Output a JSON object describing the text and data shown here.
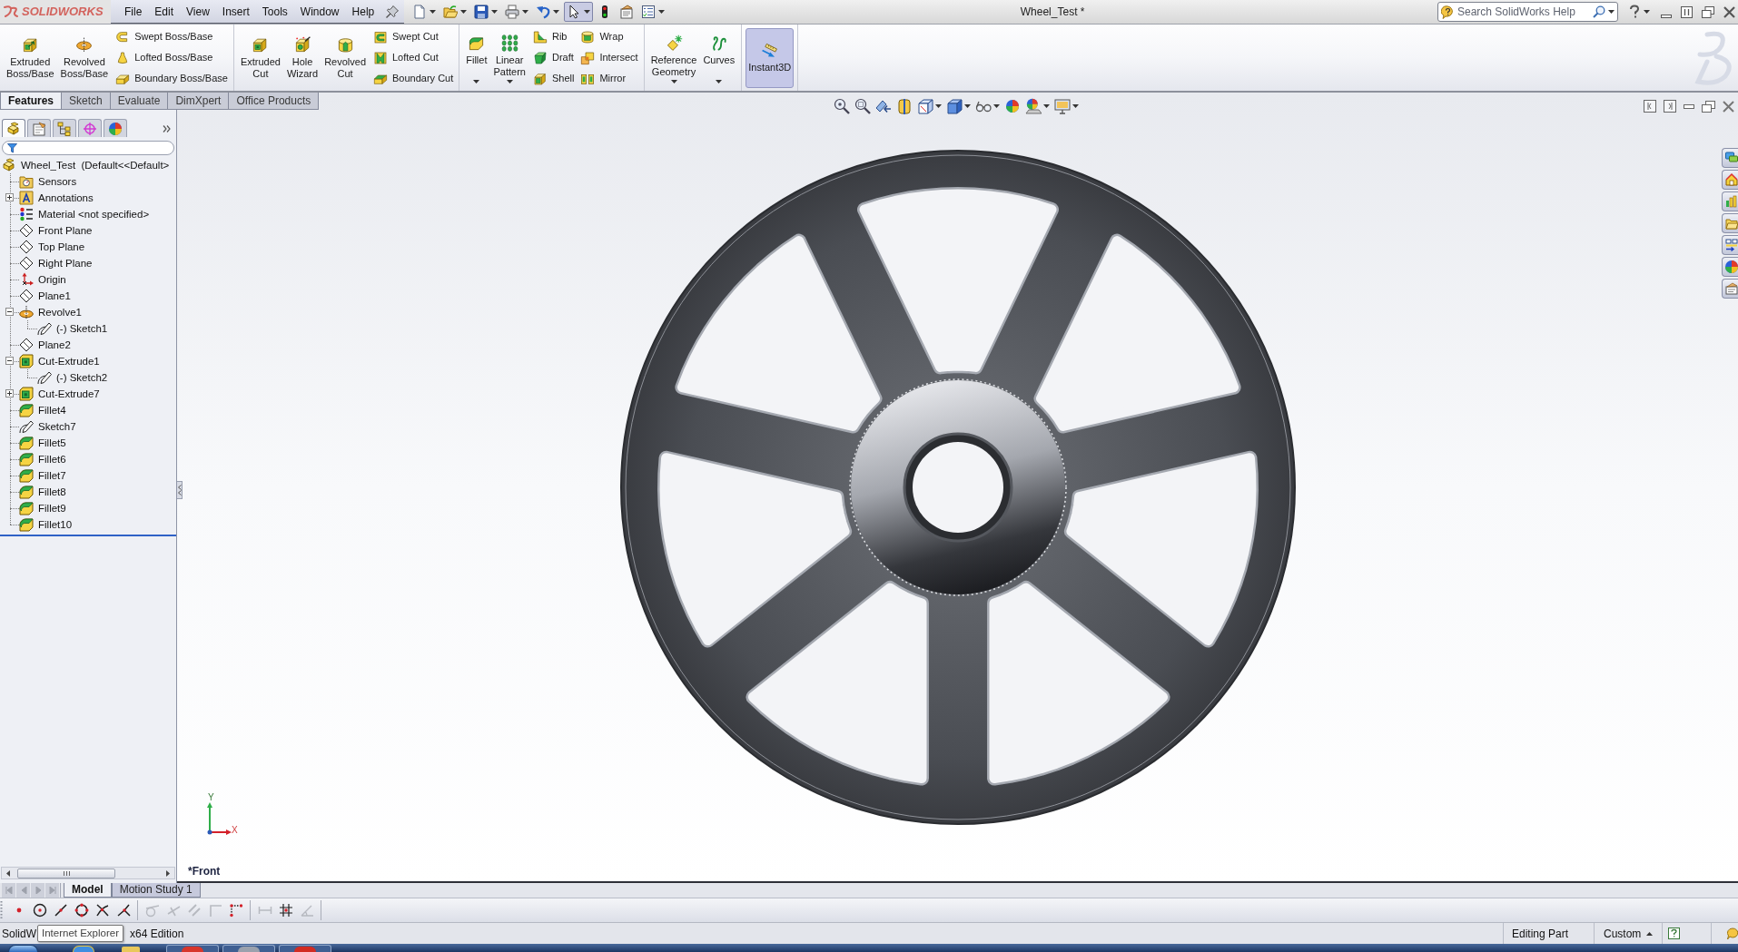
{
  "window": {
    "logo": "SOLIDWORKS",
    "title": "Wheel_Test *"
  },
  "menu": [
    "File",
    "Edit",
    "View",
    "Insert",
    "Tools",
    "Window",
    "Help"
  ],
  "quick_access": [
    {
      "kind": "new",
      "dropdown": true,
      "on": false
    },
    {
      "kind": "open",
      "dropdown": true,
      "on": false
    },
    {
      "kind": "save",
      "dropdown": true,
      "on": false
    },
    {
      "kind": "print",
      "dropdown": true,
      "on": false
    },
    {
      "kind": "undo",
      "dropdown": true,
      "on": false
    },
    {
      "kind": "select",
      "dropdown": true,
      "on": true
    },
    {
      "kind": "rebuild",
      "dropdown": false,
      "on": false
    },
    {
      "kind": "properties",
      "dropdown": false,
      "on": false
    },
    {
      "kind": "options",
      "dropdown": true,
      "on": false
    }
  ],
  "search": {
    "placeholder": "Search SolidWorks Help"
  },
  "ribbon": {
    "groups": [
      {
        "buttons": [
          {
            "kind": "extrude",
            "label": "Extruded Boss/Base",
            "dropdown": false,
            "on": false
          },
          {
            "kind": "revolve",
            "label": "Revolved Boss/Base",
            "dropdown": false,
            "on": false
          }
        ],
        "stacks": [
          [
            {
              "kind": "sweep",
              "label": "Swept Boss/Base"
            },
            {
              "kind": "loft",
              "label": "Lofted Boss/Base"
            },
            {
              "kind": "boundary",
              "label": "Boundary Boss/Base"
            }
          ]
        ]
      },
      {
        "buttons": [
          {
            "kind": "extrude-cut",
            "label": "Extruded Cut",
            "dropdown": false,
            "on": false
          },
          {
            "kind": "hole-wizard",
            "label": "Hole Wizard",
            "dropdown": false,
            "on": false
          },
          {
            "kind": "revolve-cut",
            "label": "Revolved Cut",
            "dropdown": false,
            "on": false
          }
        ],
        "stacks": [
          [
            {
              "kind": "sweep-cut",
              "label": "Swept Cut"
            },
            {
              "kind": "loft-cut",
              "label": "Lofted Cut"
            },
            {
              "kind": "boundary-cut",
              "label": "Boundary Cut"
            }
          ]
        ]
      },
      {
        "buttons": [
          {
            "kind": "fillet",
            "label": "Fillet",
            "dropdown": true,
            "on": false
          },
          {
            "kind": "pattern",
            "label": "Linear Pattern",
            "dropdown": true,
            "on": false
          }
        ],
        "stacks": [
          [
            {
              "kind": "rib",
              "label": "Rib"
            },
            {
              "kind": "draft",
              "label": "Draft"
            },
            {
              "kind": "shell",
              "label": "Shell"
            }
          ],
          [
            {
              "kind": "wrap",
              "label": "Wrap"
            },
            {
              "kind": "intersect",
              "label": "Intersect"
            },
            {
              "kind": "mirror",
              "label": "Mirror"
            }
          ]
        ]
      },
      {
        "buttons": [
          {
            "kind": "ref-geometry",
            "label": "Reference Geometry",
            "dropdown": true,
            "on": false
          },
          {
            "kind": "curves",
            "label": "Curves",
            "dropdown": true,
            "on": false
          }
        ]
      },
      {
        "buttons": [
          {
            "kind": "instant3d",
            "label": "Instant3D",
            "dropdown": false,
            "on": true
          }
        ]
      }
    ]
  },
  "tabs": [
    {
      "label": "Features",
      "selected": true
    },
    {
      "label": "Sketch",
      "selected": false
    },
    {
      "label": "Evaluate",
      "selected": false
    },
    {
      "label": "DimXpert",
      "selected": false
    },
    {
      "label": "Office Products",
      "selected": false
    }
  ],
  "manager_tabs": [
    {
      "kind": "feature",
      "selected": true
    },
    {
      "kind": "property",
      "selected": false
    },
    {
      "kind": "configuration",
      "selected": false
    },
    {
      "kind": "dimxpert",
      "selected": false
    },
    {
      "kind": "display",
      "selected": false
    }
  ],
  "feature_tree": {
    "kind": "part",
    "label": "Wheel_Test  (Default<<Default>",
    "children": [
      {
        "kind": "sensors",
        "label": "Sensors"
      },
      {
        "kind": "annotations",
        "label": "Annotations",
        "expanded": false
      },
      {
        "kind": "material",
        "label": "Material <not specified>"
      },
      {
        "kind": "plane",
        "label": "Front Plane"
      },
      {
        "kind": "plane",
        "label": "Top Plane"
      },
      {
        "kind": "plane",
        "label": "Right Plane"
      },
      {
        "kind": "origin",
        "label": "Origin"
      },
      {
        "kind": "plane",
        "label": "Plane1"
      },
      {
        "kind": "revolve",
        "label": "Revolve1",
        "expanded": true,
        "children": [
          {
            "kind": "sketch",
            "label": "(-) Sketch1"
          }
        ]
      },
      {
        "kind": "plane",
        "label": "Plane2"
      },
      {
        "kind": "cut-extrude",
        "label": "Cut-Extrude1",
        "expanded": true,
        "children": [
          {
            "kind": "sketch",
            "label": "(-) Sketch2"
          }
        ]
      },
      {
        "kind": "cut-extrude",
        "label": "Cut-Extrude7",
        "expanded": false
      },
      {
        "kind": "fillet",
        "label": "Fillet4"
      },
      {
        "kind": "sketch",
        "label": "Sketch7"
      },
      {
        "kind": "fillet",
        "label": "Fillet5"
      },
      {
        "kind": "fillet",
        "label": "Fillet6"
      },
      {
        "kind": "fillet",
        "label": "Fillet7"
      },
      {
        "kind": "fillet",
        "label": "Fillet8"
      },
      {
        "kind": "fillet",
        "label": "Fillet9"
      },
      {
        "kind": "fillet",
        "label": "Fillet10"
      }
    ]
  },
  "viewport": {
    "view_label": "*Front",
    "triad": {
      "x_label": "X",
      "y_label": "Y"
    },
    "toolbar": [
      {
        "kind": "zoom-fit",
        "dropdown": false
      },
      {
        "kind": "zoom-area",
        "dropdown": false
      },
      {
        "kind": "previous-view",
        "dropdown": false
      },
      {
        "kind": "section-view",
        "dropdown": false
      },
      {
        "kind": "view-orientation",
        "dropdown": true
      },
      {
        "kind": "display-style",
        "dropdown": true
      },
      {
        "kind": "hide-show",
        "dropdown": true
      },
      {
        "kind": "appearance",
        "dropdown": false
      },
      {
        "kind": "scene",
        "dropdown": true
      },
      {
        "kind": "view-settings",
        "dropdown": true
      }
    ]
  },
  "bottom_tabs": [
    {
      "label": "Model",
      "selected": true
    },
    {
      "label": "Motion Study 1",
      "selected": false
    }
  ],
  "sketch_toolbar": [
    [
      {
        "kind": "point",
        "disabled": false
      },
      {
        "kind": "center",
        "disabled": false
      },
      {
        "kind": "midpoint",
        "disabled": false
      },
      {
        "kind": "quadrant",
        "disabled": false
      },
      {
        "kind": "intersection",
        "disabled": false
      },
      {
        "kind": "nearest",
        "disabled": false
      }
    ],
    [
      {
        "kind": "tangent",
        "disabled": true
      },
      {
        "kind": "perpendicular",
        "disabled": true
      },
      {
        "kind": "parallel",
        "disabled": true
      },
      {
        "kind": "horizontal",
        "disabled": true
      },
      {
        "kind": "endpoint",
        "disabled": false
      }
    ],
    [
      {
        "kind": "distance",
        "disabled": true
      },
      {
        "kind": "grid",
        "disabled": false
      },
      {
        "kind": "angle",
        "disabled": true
      }
    ]
  ],
  "status_bar": {
    "product_start": "SolidW",
    "product_end": "x64 Edition",
    "mode": "Editing Part",
    "units": "Custom"
  },
  "tooltip": "Internet Explorer"
}
